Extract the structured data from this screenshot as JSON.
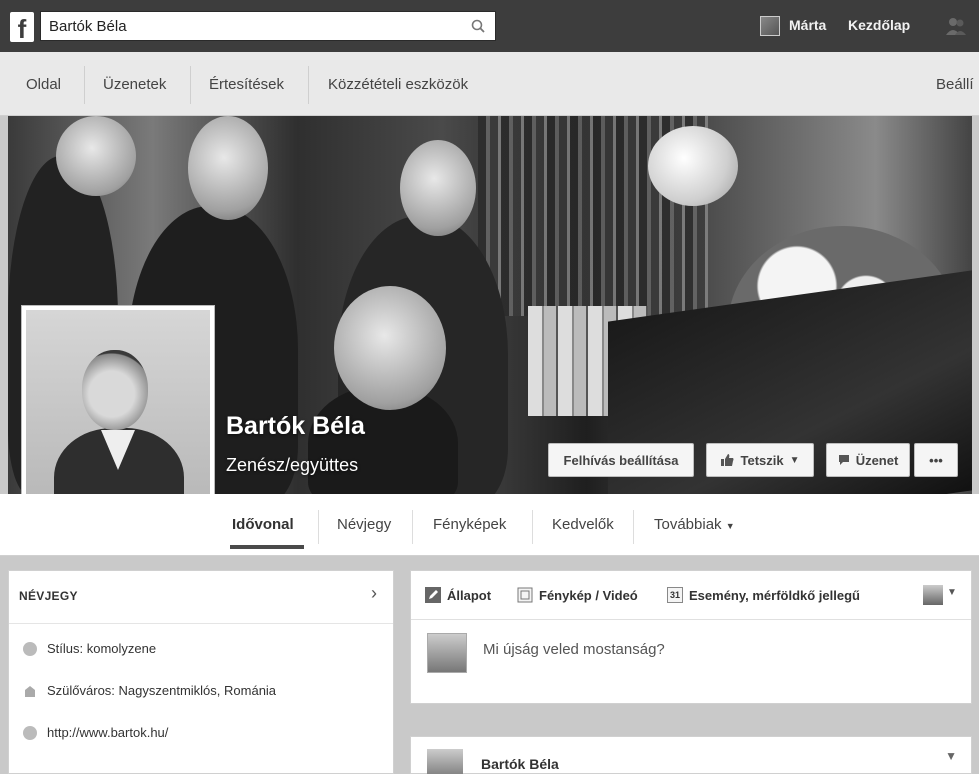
{
  "topbar": {
    "search_value": "Bartók Béla",
    "user_name": "Márta",
    "home_label": "Kezdőlap"
  },
  "adminbar": {
    "items": [
      "Oldal",
      "Üzenetek",
      "Értesítések",
      "Közzétételi eszközök"
    ],
    "settings_label": "Beállí"
  },
  "cover": {
    "page_name": "Bartók Béla",
    "category": "Zenész/együttes",
    "buttons": {
      "cta": "Felhívás beállítása",
      "like": "Tetszik",
      "message": "Üzenet",
      "more": "•••"
    }
  },
  "tabs": [
    "Idővonal",
    "Névjegy",
    "Fényképek",
    "Kedvelők",
    "Továbbiak"
  ],
  "about": {
    "title": "NÉVJEGY",
    "rows": [
      {
        "icon": "music-icon",
        "text": "Stílus: komolyzene"
      },
      {
        "icon": "home-icon",
        "text": "Szülőváros: Nagyszentmiklós, Románia"
      },
      {
        "icon": "globe-icon",
        "text": "http://www.bartok.hu/"
      }
    ]
  },
  "composer": {
    "tabs": [
      "Állapot",
      "Fénykép / Videó",
      "Esemény, mérföldkő jellegű"
    ],
    "event_icon_number": "31",
    "placeholder": "Mi újság veled mostanság?"
  },
  "post": {
    "author": "Bartók Béla"
  },
  "colors": {
    "topbar_bg": "#3d3d3d",
    "page_bg": "#c9c9c9",
    "card_bg": "#ffffff"
  }
}
